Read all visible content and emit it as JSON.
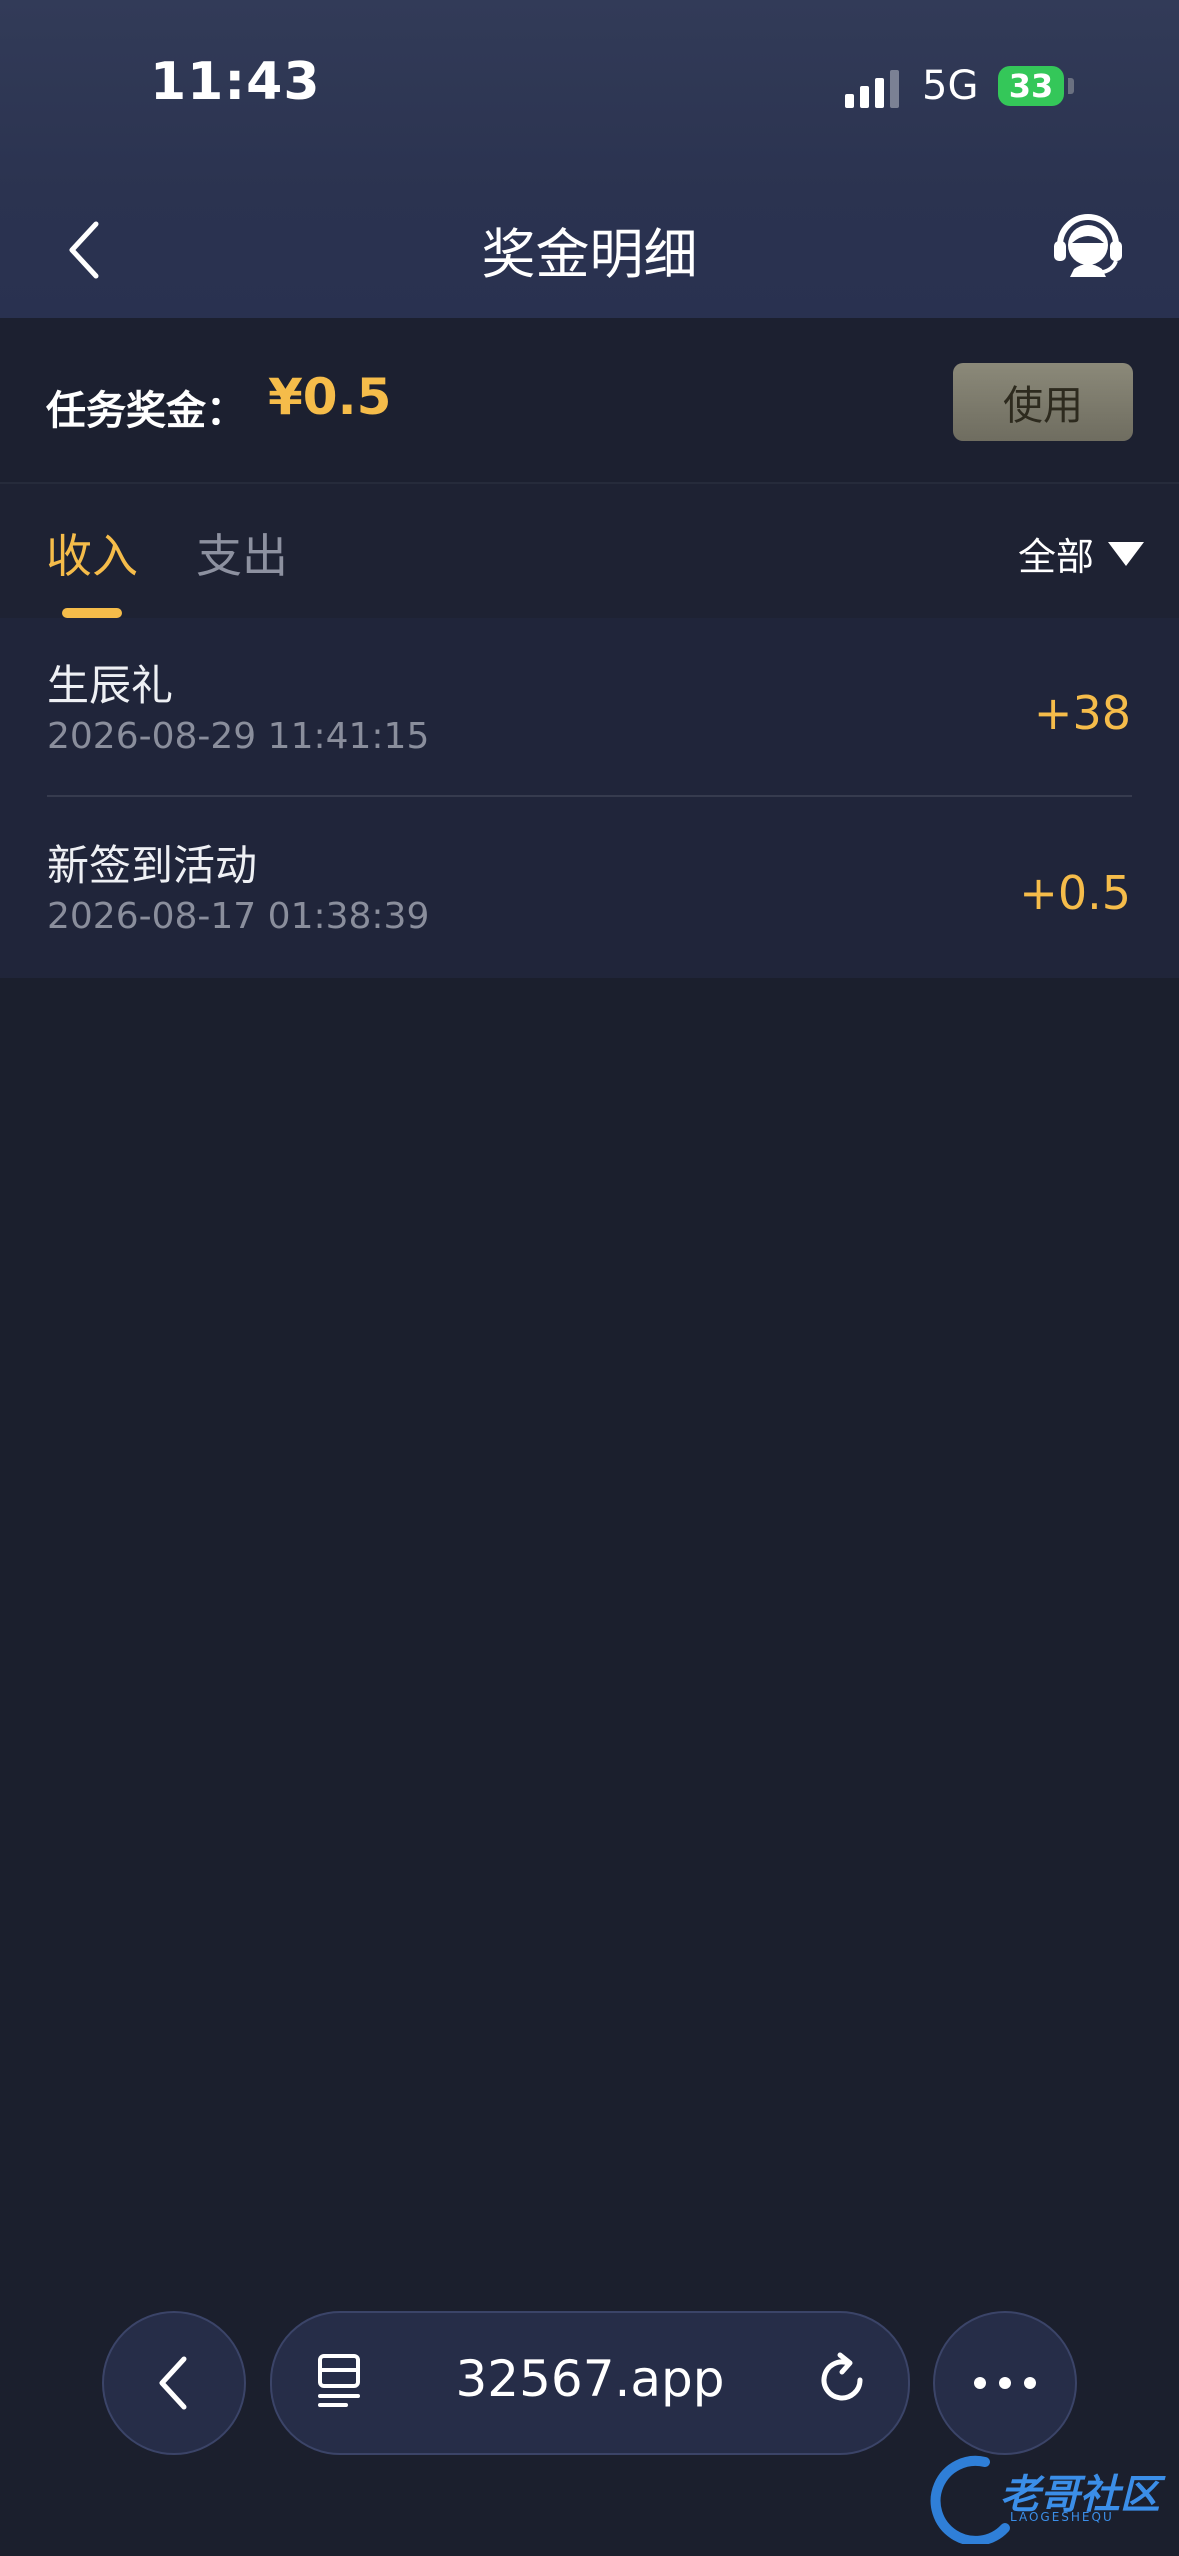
{
  "status_bar": {
    "time": "11:43",
    "network": "5G",
    "battery": "33"
  },
  "header": {
    "title": "奖金明细",
    "back_icon": "chevron-left-icon",
    "support_icon": "customer-service-icon"
  },
  "bonus": {
    "label": "任务奖金：",
    "value": "¥0.5",
    "use_button": "使用"
  },
  "tabs": {
    "income": "收入",
    "expense": "支出",
    "active": "收入",
    "filter": "全部"
  },
  "records": [
    {
      "title": "生辰礼",
      "time": "2026-08-29 11:41:15",
      "amount": "+38"
    },
    {
      "title": "新签到活动",
      "time": "2026-08-17 01:38:39",
      "amount": "+0.5"
    }
  ],
  "browser": {
    "url": "32567.app"
  },
  "watermark": {
    "text": "老哥社区",
    "sub": "LAOGESHEQU"
  },
  "colors": {
    "accent": "#f5bc4a",
    "background": "#1b1f2d",
    "header": "#2b3350"
  }
}
